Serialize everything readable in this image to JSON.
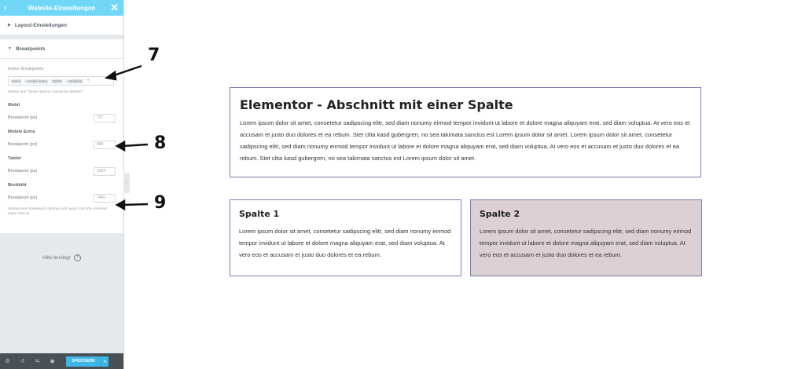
{
  "sidebar": {
    "title": "Website-Einstellungen",
    "back_icon": "chevron-left-icon",
    "close_icon": "close-icon",
    "layout_section": "Layout-Einstellungen",
    "breakpoints_section": "Breakpoints",
    "active_breakpoints_label": "Active Breakpoints",
    "tags": [
      "Mobil",
      "Mobile Extra",
      "Tablet",
      "Breitbild"
    ],
    "tag_add": "+",
    "note_top": "Mobile and Tablet options cannot be deleted.",
    "devices": [
      {
        "name": "Mobil",
        "field_label": "Breakpoint (px)",
        "value": "767"
      },
      {
        "name": "Mobile Extra",
        "field_label": "Breakpoint (px)",
        "value": "880"
      },
      {
        "name": "Tablet",
        "field_label": "Breakpoint (px)",
        "value": "1024"
      },
      {
        "name": "Breitbild",
        "field_label": "Breakpoint (px)",
        "value": "2400"
      }
    ],
    "note_bottom": "Widescreen breakpoint settings will apply from the selected value and up.",
    "help_text": "Hilfe benötigt",
    "help_icon": "?",
    "save_label": "SPEICHERN",
    "save_arrow": "▴",
    "collapse_glyph": "‹"
  },
  "annotations": [
    "7",
    "8",
    "9"
  ],
  "canvas": {
    "top_box": {
      "title": "Elementor - Abschnitt mit einer Spalte",
      "text": "Lorem ipsum dolor sit amet, consetetur sadipscing elitr, sed diam nonumy eirmod tempor invidunt ut labore et dolore magna aliquyam erat, sed diam voluptua. At vero eos et accusam et justo duo dolores et ea rebum. Stet clita kasd gubergren, no sea takimata sanctus est Lorem ipsum dolor sit amet. Lorem ipsum dolor sit amet, consetetur sadipscing elitr, sed diam nonumy eirmod tempor invidunt ut labore et dolore magna aliquyam erat, sed diam voluptua. At vero eos et accusam et justo duo dolores et ea rebum. Stet clita kasd gubergren, no sea takimata sanctus est Lorem ipsum dolor sit amet."
    },
    "col1": {
      "title": "Spalte 1",
      "text": "Lorem ipsum dolor sit amet, consetetur sadipscing elitr, sed diam nonumy eirmod tempor invidunt ut labore et dolore magna aliquyam erat, sed diam voluptua. At vero eos et accusam et justo duo dolores et ea rebum."
    },
    "col2": {
      "title": "Spalte 2",
      "text": "Lorem ipsum dolor sit amet, consetetur sadipscing elitr, sed diam nonumy eirmod tempor invidunt ut labore et dolore magna aliquyam erat, sed diam voluptua. At vero eos et accusam et justo duo dolores et ea rebum."
    }
  },
  "colors": {
    "header": "#71d7f7",
    "border": "#7c7fb0",
    "col2_bg": "#ddd0d4",
    "save": "#3fb6e8",
    "toolbar": "#495157"
  }
}
